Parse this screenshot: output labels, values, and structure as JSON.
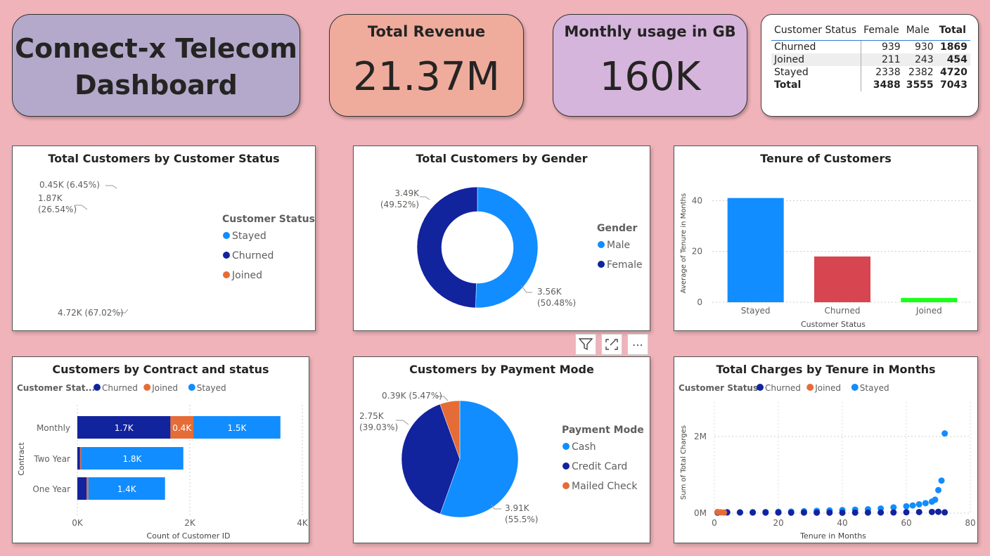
{
  "title": {
    "line1": "Connect-x Telecom",
    "line2": "Dashboard"
  },
  "kpis": [
    {
      "title": "Total Revenue",
      "value": "21.37M",
      "bg": "#efac9c"
    },
    {
      "title": "Monthly usage in GB",
      "value": "160K",
      "bg": "#d6b5dc"
    }
  ],
  "matrix": {
    "headers": [
      "Customer Status",
      "Female",
      "Male",
      "Total"
    ],
    "rows": [
      {
        "label": "Churned",
        "female": "939",
        "male": "930",
        "total": "1869"
      },
      {
        "label": "Joined",
        "female": "211",
        "male": "243",
        "total": "454"
      },
      {
        "label": "Stayed",
        "female": "2338",
        "male": "2382",
        "total": "4720"
      }
    ],
    "total": {
      "label": "Total",
      "female": "3488",
      "male": "3555",
      "total": "7043"
    }
  },
  "visual_buttons": {
    "filter": "filter-icon",
    "focus": "focus-mode-icon",
    "more": "⋯"
  },
  "colors": {
    "stayed": "#118dff",
    "churned": "#12239e",
    "joined": "#e66c37",
    "bar_churned": "#d64550",
    "bar_joined": "#1aff1a"
  },
  "chart_data": [
    {
      "type": "pie",
      "title": "Total Customers by Customer Status",
      "legend_title": "Customer Status",
      "legend_position": "right",
      "slices": [
        {
          "name": "Stayed",
          "value": 4720,
          "label": "4.72K (67.02%)"
        },
        {
          "name": "Churned",
          "value": 1869,
          "label_line1": "1.87K",
          "label_line2": "(26.54%)"
        },
        {
          "name": "Joined",
          "value": 454,
          "label": "0.45K (6.45%)"
        }
      ]
    },
    {
      "type": "pie",
      "variant": "donut",
      "title": "Total Customers by Gender",
      "legend_title": "Gender",
      "legend_position": "right",
      "slices": [
        {
          "name": "Male",
          "value": 3555,
          "label_line1": "3.56K",
          "label_line2": "(50.48%)"
        },
        {
          "name": "Female",
          "value": 3488,
          "label_line1": "3.49K",
          "label_line2": "(49.52%)"
        }
      ]
    },
    {
      "type": "bar",
      "title": "Tenure of Customers",
      "categories": [
        "Stayed",
        "Churned",
        "Joined"
      ],
      "values": [
        41.0,
        18.0,
        1.7
      ],
      "xlabel": "Customer Status",
      "ylabel": "Average of Tenure in Months",
      "ylim": [
        0,
        47
      ],
      "yticks": [
        "0",
        "20",
        "40"
      ],
      "grid": true
    },
    {
      "type": "bar",
      "orientation": "horizontal",
      "stacked": true,
      "title": "Customers by Contract and status",
      "legend_title": "Customer Stat...",
      "legend_position": "top",
      "categories": [
        "Monthly",
        "Two Year",
        "One Year"
      ],
      "series": [
        {
          "name": "Churned",
          "values": [
            1655,
            48,
            166
          ],
          "labels": [
            "1.7K",
            "",
            ""
          ]
        },
        {
          "name": "Joined",
          "values": [
            408,
            16,
            30
          ],
          "labels": [
            "0.4K",
            "",
            ""
          ]
        },
        {
          "name": "Stayed",
          "values": [
            1547,
            1820,
            1363
          ],
          "labels": [
            "1.5K",
            "1.8K",
            "1.4K"
          ]
        }
      ],
      "xlabel": "Count of Customer ID",
      "ylabel": "Contract",
      "xlim": [
        0,
        4000
      ],
      "xticks": [
        "0K",
        "2K",
        "4K"
      ],
      "grid": true
    },
    {
      "type": "pie",
      "title": "Customers by Payment Mode",
      "legend_title": "Payment Mode",
      "legend_position": "right",
      "slices": [
        {
          "name": "Cash",
          "value": 3910,
          "label_line1": "3.91K",
          "label_line2": "(55.5%)"
        },
        {
          "name": "Credit Card",
          "value": 2750,
          "label_line1": "2.75K",
          "label_line2": "(39.03%)"
        },
        {
          "name": "Mailed Check",
          "value": 390,
          "label": "0.39K (5.47%)"
        }
      ]
    },
    {
      "type": "scatter",
      "title": "Total Charges by Tenure in Months",
      "legend_title": "Customer Status",
      "legend_position": "top",
      "xlabel": "Tenure in Months",
      "ylabel": "Sum of Total Charges",
      "xlim": [
        0,
        80
      ],
      "ylim": [
        0,
        2900000
      ],
      "xticks": [
        "0",
        "20",
        "40",
        "60",
        "80"
      ],
      "yticks": [
        "0M",
        "2M"
      ],
      "grid": true,
      "series": [
        {
          "name": "Churned",
          "x": [
            1,
            4,
            8,
            12,
            16,
            20,
            24,
            28,
            32,
            36,
            40,
            44,
            48,
            52,
            56,
            60,
            64,
            68,
            70,
            72
          ],
          "y": [
            20000,
            22000,
            18000,
            15000,
            14000,
            15000,
            12000,
            14000,
            12000,
            12000,
            11000,
            13000,
            14000,
            16000,
            18000,
            22000,
            28000,
            30000,
            35000,
            20000
          ]
        },
        {
          "name": "Joined",
          "x": [
            1,
            2,
            3
          ],
          "y": [
            30000,
            20000,
            15000
          ]
        },
        {
          "name": "Stayed",
          "x": [
            1,
            4,
            8,
            12,
            16,
            20,
            24,
            28,
            32,
            36,
            40,
            44,
            48,
            52,
            56,
            60,
            62,
            64,
            66,
            68,
            69,
            70,
            71,
            72
          ],
          "y": [
            10000,
            15000,
            20000,
            25000,
            30000,
            35000,
            40000,
            50000,
            60000,
            70000,
            80000,
            90000,
            100000,
            120000,
            150000,
            180000,
            200000,
            230000,
            260000,
            300000,
            350000,
            600000,
            850000,
            2080000
          ]
        }
      ]
    }
  ]
}
